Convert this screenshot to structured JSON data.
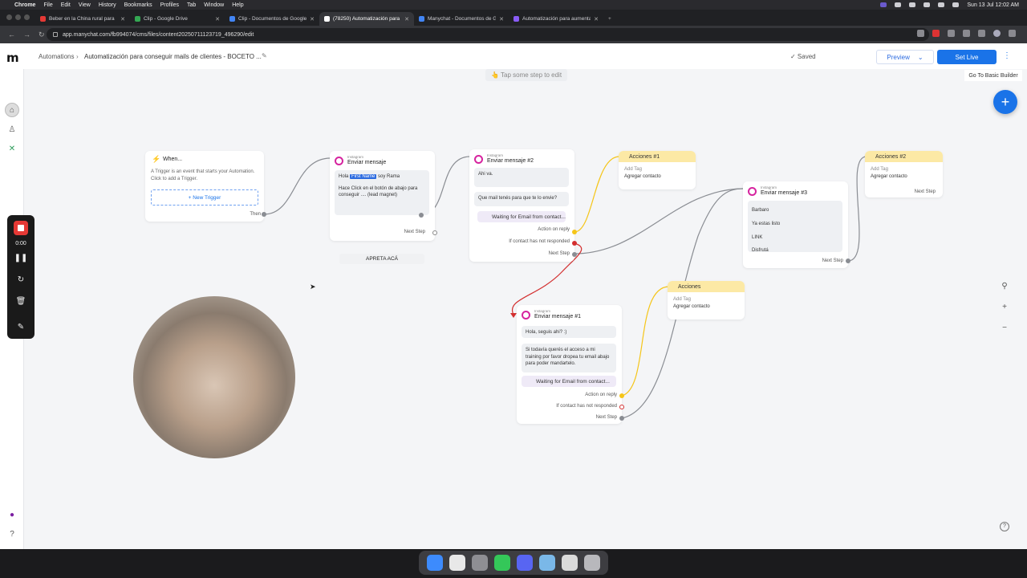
{
  "menubar": {
    "app": "Chrome",
    "items": [
      "File",
      "Edit",
      "View",
      "History",
      "Bookmarks",
      "Profiles",
      "Tab",
      "Window",
      "Help"
    ],
    "clock": "Sun 13 Jul  12:02 AM"
  },
  "tabs": [
    {
      "title": "Beber en la China rural para",
      "color": "#e53935"
    },
    {
      "title": "Clip - Google Drive",
      "color": "#34a853"
    },
    {
      "title": "Clip - Documentos de Google",
      "color": "#4285f4"
    },
    {
      "title": "(78250) Automatización para",
      "color": "#ffffff"
    },
    {
      "title": "Manychat - Documentos de G",
      "color": "#4285f4"
    },
    {
      "title": "Automatización para aumenta",
      "color": "#8a5cf6"
    }
  ],
  "url": "app.manychat.com/fb994074/cms/files/content20250711123719_496290/edit",
  "header": {
    "logo": "m",
    "crumb1": "Automations",
    "crumb2": "Automatización para conseguir mails de clientes - BOCETO ...",
    "saved": "✓ Saved",
    "preview": "Preview",
    "setlive": "Set Live"
  },
  "canvas": {
    "tap_hint": "👆 Tap some step to edit",
    "basic_builder": "Go To Basic Builder"
  },
  "recorder": {
    "time": "0:00"
  },
  "trigger": {
    "title": "When...",
    "desc": "A Trigger is an event that starts your Automation. Click to add a Trigger.",
    "new_trigger": "+ New Trigger",
    "then": "Then"
  },
  "msg1": {
    "sub": "Instagram",
    "title": "Enviar mensaje",
    "hola": "Hola",
    "first_name": "First Name",
    "soy": "soy Rama",
    "body": "Hace Click en el botón de abajo para conseguir .... (lead magnet)",
    "button": "APRETA ACÁ",
    "next": "Next Step"
  },
  "msg2": {
    "sub": "Instagram",
    "title": "Enviar mensaje #2",
    "b1": "Ahi va.",
    "b2": "Que mail tenés para que te lo envie?",
    "wait": "Waiting for Email from contact...",
    "action": "Action on reply",
    "noresp": "If contact has not responded",
    "next": "Next Step"
  },
  "acc1": {
    "title": "Acciones #1",
    "add": "Add Tag",
    "val": "Agregar contacto"
  },
  "msg3": {
    "sub": "Instagram",
    "title": "Enviar mensaje #3",
    "lines": [
      "Barbaro",
      "Ya estas listo",
      "LINK",
      "Disfrutá"
    ],
    "next": "Next Step"
  },
  "acc2": {
    "title": "Acciones #2",
    "add": "Add Tag",
    "val": "Agregar contacto",
    "next": "Next Step"
  },
  "acc3": {
    "title": "Acciones",
    "add": "Add Tag",
    "val": "Agregar contacto"
  },
  "msg4": {
    "sub": "Instagram",
    "title": "Enviar mensaje #1",
    "b1": "Hola, seguis ahi? :)",
    "b2": "Si todavía querés el acceso a mi training por favor dropea tu email abajo para poder mandartelo.",
    "wait": "Waiting for Email from contact...",
    "action": "Action on reply",
    "noresp": "If contact has not responded",
    "next": "Next Step"
  },
  "colors": {
    "accent": "#1a73e8",
    "action_head": "#fce9a5",
    "instagram": "#d6249f",
    "error_link": "#d32f2f",
    "action_link": "#f5c518",
    "link": "#8a8d93"
  }
}
